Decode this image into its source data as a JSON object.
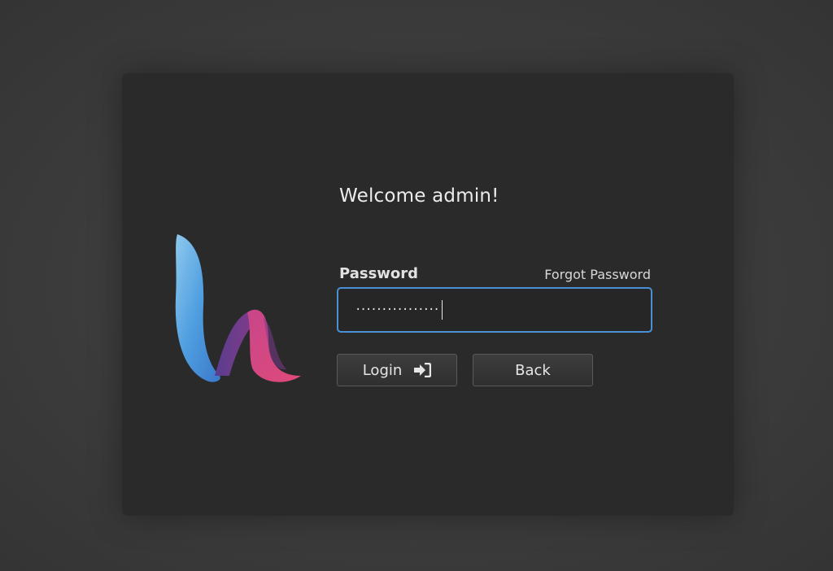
{
  "login": {
    "welcome": "Welcome admin!",
    "password_label": "Password",
    "forgot_label": "Forgot Password",
    "password_mask": "················",
    "login_label": "Login",
    "back_label": "Back"
  },
  "icons": {
    "logo": "brand-logo-icon",
    "login": "sign-in-arrow-icon"
  },
  "colors": {
    "accent": "#4a90d9",
    "card_bg": "#2a2a2a",
    "page_bg": "#3a3a3a"
  }
}
